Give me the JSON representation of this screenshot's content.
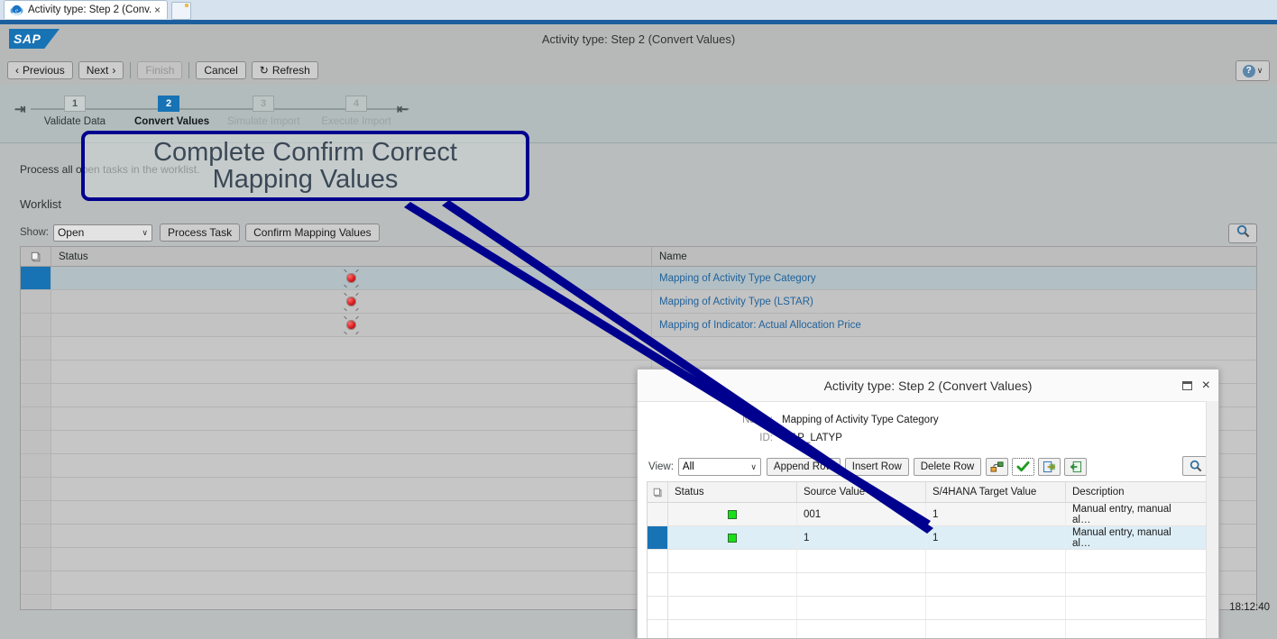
{
  "browser": {
    "tab_title": "Activity type: Step 2  (Conv...",
    "tab_close": "×",
    "favicon": "internet-explorer-icon",
    "new_tab": "new-tab-icon"
  },
  "header": {
    "logo": "SAP",
    "title": "Activity type: Step 2  (Convert Values)"
  },
  "toolbar": {
    "previous": "Previous",
    "next": "Next",
    "finish": "Finish",
    "cancel": "Cancel",
    "refresh": "Refresh",
    "prev_chevron": "‹",
    "next_chevron": "›",
    "refresh_icon": "↻",
    "help_label": "?",
    "help_chevron": "∨"
  },
  "wizard": {
    "start_icon": "⇥",
    "end_icon": "⇤",
    "steps": [
      {
        "num": "1",
        "label": "Validate Data",
        "state": "done"
      },
      {
        "num": "2",
        "label": "Convert Values",
        "state": "active"
      },
      {
        "num": "3",
        "label": "Simulate Import",
        "state": "disabled"
      },
      {
        "num": "4",
        "label": "Execute Import",
        "state": "disabled"
      }
    ]
  },
  "page": {
    "description": "Process all open tasks in the worklist.",
    "worklist_heading": "Worklist"
  },
  "worklist_toolbar": {
    "show_label": "Show:",
    "show_value": "Open",
    "show_chevron": "∨",
    "process_task": "Process Task",
    "confirm_mapping": "Confirm Mapping Values",
    "search_icon": "search-icon"
  },
  "worklist_table": {
    "columns": [
      "Status",
      "Name"
    ],
    "row_marker_icon": "copy-icon",
    "rows": [
      {
        "status": "error",
        "name": "Mapping of Activity Type Category",
        "selected": true
      },
      {
        "status": "error",
        "name": "Mapping of Activity Type (LSTAR)",
        "selected": false
      },
      {
        "status": "error",
        "name": "Mapping of Indicator: Actual Allocation Price",
        "selected": false
      }
    ],
    "empty_row_count": 13
  },
  "dialog": {
    "title": "Activity type: Step 2 (Convert Values)",
    "maximize_icon": "maximize-icon",
    "close_icon": "×",
    "fields": [
      {
        "label": "Name:",
        "value": "Mapping of Activity Type Category"
      },
      {
        "label": "ID:",
        "value": "MAP_LATYP"
      }
    ],
    "toolbar": {
      "view_label": "View:",
      "view_value": "All",
      "view_chevron": "∨",
      "append_row": "Append Row",
      "insert_row": "Insert Row",
      "delete_row": "Delete Row",
      "icons": [
        "mapping-icon",
        "confirm-check-icon",
        "export-icon",
        "import-icon"
      ],
      "search_icon": "search-icon"
    },
    "table": {
      "columns": [
        "Status",
        "Source Value",
        "S/4HANA Target Value",
        "Description"
      ],
      "row_marker_icon": "copy-icon",
      "rows": [
        {
          "status": "ok",
          "source": "001",
          "target": "1",
          "description": "Manual entry, manual al…",
          "selected": false
        },
        {
          "status": "ok",
          "source": "1",
          "target": "1",
          "description": "Manual entry, manual al…",
          "selected": true
        }
      ],
      "empty_row_count": 4
    }
  },
  "annotation": {
    "line1": "Complete Confirm Correct",
    "line2": "Mapping Values",
    "border_color": "#00008f",
    "text_color": "#3b4856"
  },
  "status_bar": {
    "time": "18:12:40"
  }
}
